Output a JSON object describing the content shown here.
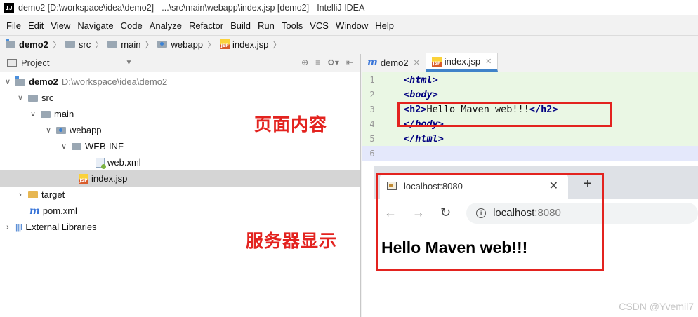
{
  "window": {
    "title": "demo2 [D:\\workspace\\idea\\demo2] - ...\\src\\main\\webapp\\index.jsp [demo2] - IntelliJ IDEA",
    "logo": "IJ"
  },
  "menu": [
    "File",
    "Edit",
    "View",
    "Navigate",
    "Code",
    "Analyze",
    "Refactor",
    "Build",
    "Run",
    "Tools",
    "VCS",
    "Window",
    "Help"
  ],
  "breadcrumb": [
    "demo2",
    "src",
    "main",
    "webapp",
    "index.jsp"
  ],
  "project_panel": {
    "title": "Project",
    "tree": [
      {
        "label": "demo2",
        "path": "D:\\workspace\\idea\\demo2"
      },
      {
        "label": "src"
      },
      {
        "label": "main"
      },
      {
        "label": "webapp"
      },
      {
        "label": "WEB-INF"
      },
      {
        "label": "web.xml"
      },
      {
        "label": "index.jsp"
      },
      {
        "label": "target"
      },
      {
        "label": "pom.xml"
      },
      {
        "label": "External Libraries"
      }
    ]
  },
  "annotations": {
    "page_content": "页面内容",
    "server_display": "服务器显示"
  },
  "editor": {
    "tabs": [
      {
        "label": "demo2",
        "icon": "maven-m-icon"
      },
      {
        "label": "index.jsp",
        "icon": "jsp-file-icon"
      }
    ],
    "line_numbers": [
      "1",
      "2",
      "3",
      "4",
      "5",
      "6"
    ],
    "code": {
      "l1": "<html>",
      "l2": "<body>",
      "l3_open": "<h2>",
      "l3_text": "Hello Maven web!!!",
      "l3_close": "</h2>",
      "l4": "</body>",
      "l5": "</html>"
    }
  },
  "browser": {
    "tab_title": "localhost:8080",
    "url_host": "localhost",
    "url_port": ":8080",
    "heading": "Hello Maven web!!!"
  },
  "watermark": "CSDN @Yvemil7",
  "colors": {
    "annotation_red": "#e3231f",
    "tag_navy": "#000080",
    "selection_gray": "#d5d5d5"
  }
}
